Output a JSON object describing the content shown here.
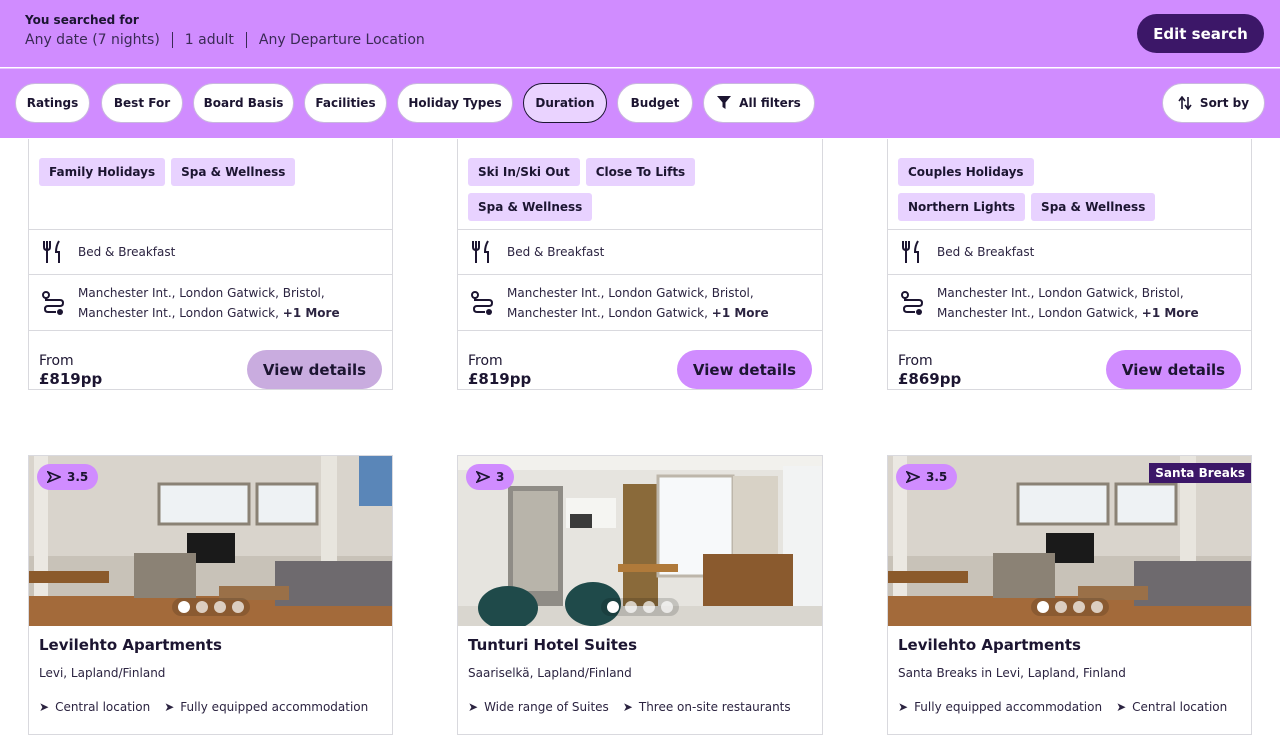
{
  "search_summary": {
    "label": "You searched for",
    "date": "Any date (7 nights)",
    "travellers": "1 adult",
    "departure": "Any Departure Location",
    "edit_label": "Edit search"
  },
  "filters": {
    "chips": [
      "Ratings",
      "Best For",
      "Board Basis",
      "Facilities",
      "Holiday Types",
      "Duration",
      "Budget"
    ],
    "active": "Duration",
    "all_filters_label": "All filters",
    "sort_label": "Sort by"
  },
  "upper_cards": [
    {
      "tags": [
        "Family Holidays",
        "Spa & Wellness"
      ],
      "board": "Bed & Breakfast",
      "airports_line1": "Manchester Int., London Gatwick, Bristol,",
      "airports_line2": "Manchester Int., London Gatwick,",
      "more": "+1 More",
      "from_label": "From",
      "price": "£819pp",
      "button": "View details"
    },
    {
      "tags": [
        "Ski In/Ski Out",
        "Close To Lifts",
        "Spa & Wellness"
      ],
      "board": "Bed & Breakfast",
      "airports_line1": "Manchester Int., London Gatwick, Bristol,",
      "airports_line2": "Manchester Int., London Gatwick,",
      "more": "+1 More",
      "from_label": "From",
      "price": "£819pp",
      "button": "View details"
    },
    {
      "tags": [
        "Couples Holidays",
        "Northern Lights",
        "Spa & Wellness"
      ],
      "board": "Bed & Breakfast",
      "airports_line1": "Manchester Int., London Gatwick, Bristol,",
      "airports_line2": "Manchester Int., London Gatwick,",
      "more": "+1 More",
      "from_label": "From",
      "price": "£869pp",
      "button": "View details"
    }
  ],
  "lower_cards": [
    {
      "rating": "3.5",
      "name": "Levilehto Apartments",
      "location": "Levi, Lapland/Finland",
      "features": [
        "Central location",
        "Fully equipped accommodation"
      ],
      "ribbon": "",
      "photo_style": "living-room"
    },
    {
      "rating": "3",
      "name": "Tunturi Hotel Suites",
      "location": "Saariselkä, Lapland/Finland",
      "features": [
        "Wide range of Suites",
        "Three on-site restaurants"
      ],
      "ribbon": "",
      "photo_style": "kitchen"
    },
    {
      "rating": "3.5",
      "name": "Levilehto Apartments",
      "location": "Santa Breaks in Levi, Lapland, Finland",
      "features": [
        "Fully equipped accommodation",
        "Central location"
      ],
      "ribbon": "Santa Breaks",
      "photo_style": "living-room"
    }
  ],
  "colors": {
    "brand": "#d08cff",
    "brand_dark": "#3c1768",
    "tag_bg": "#e8d2ff"
  }
}
